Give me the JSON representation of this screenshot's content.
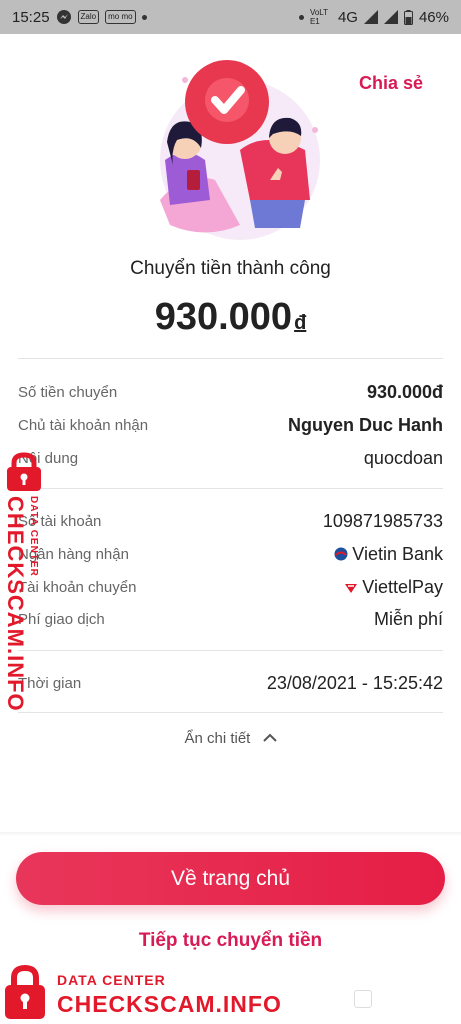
{
  "status_bar": {
    "time": "15:25",
    "left_icons": [
      "messenger-icon",
      "zalo-icon",
      "momo-icon"
    ],
    "zalo": "Zalo",
    "momo": "mo mo",
    "volte": "VoLTE1",
    "network": "4G",
    "battery": "46%"
  },
  "header": {
    "share_label": "Chia sẻ"
  },
  "result": {
    "title": "Chuyển tiền thành công",
    "amount": "930.000",
    "currency": "đ"
  },
  "details": [
    {
      "label": "Số tiền chuyển",
      "value": "930.000đ"
    },
    {
      "label": "Chủ tài khoản nhận",
      "value": "Nguyen Duc Hanh"
    },
    {
      "label": "Nội dung",
      "value": "quocdoan"
    },
    {
      "label": "Số tài khoản",
      "value": "109871985733"
    },
    {
      "label": "Ngân hàng nhận",
      "value": "Vietin Bank",
      "icon": "vietinbank-logo-icon"
    },
    {
      "label": "Tài khoản chuyển",
      "value": "ViettelPay",
      "icon": "viettelpay-logo-icon"
    },
    {
      "label": "Phí giao dịch",
      "value": "Miễn phí"
    },
    {
      "label": "Thời gian",
      "value": "23/08/2021 - 15:25:42"
    }
  ],
  "toggle": {
    "label": "Ẩn chi tiết"
  },
  "actions": {
    "home_label": "Về trang chủ",
    "continue_label": "Tiếp tục chuyển tiền"
  },
  "watermark": {
    "line1": "DATA CENTER",
    "line2": "CHECKSCAM.INFO"
  },
  "colors": {
    "accent": "#d81b55",
    "button": "#e8365a",
    "watermark": "#e2192b"
  }
}
